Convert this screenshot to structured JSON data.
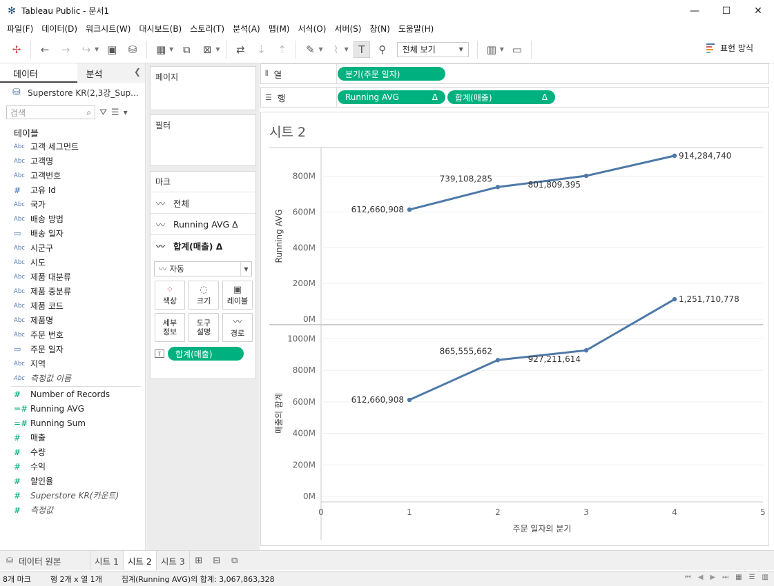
{
  "window": {
    "title": "Tableau Public - 문서1",
    "minimize": "—",
    "maximize": "☐",
    "close": "✕"
  },
  "menu": [
    "파일(F)",
    "데이터(D)",
    "워크시트(W)",
    "대시보드(B)",
    "스토리(T)",
    "분석(A)",
    "맵(M)",
    "서식(O)",
    "서버(S)",
    "창(N)",
    "도움말(H)"
  ],
  "toolbar": {
    "view_select": "전체 보기",
    "show_me": "표현 방식"
  },
  "datapane": {
    "tab_data": "데이터",
    "tab_analysis": "분석",
    "datasource": "Superstore KR(2,3강_Sup...",
    "search_placeholder": "검색",
    "tables_title": "테이블",
    "dimensions": [
      {
        "type": "Abc",
        "name": "고객 세그먼트"
      },
      {
        "type": "Abc",
        "name": "고객명"
      },
      {
        "type": "Abc",
        "name": "고객번호"
      },
      {
        "type": "#",
        "name": "고유 Id"
      },
      {
        "type": "Abc",
        "name": "국가"
      },
      {
        "type": "Abc",
        "name": "배송 방법"
      },
      {
        "type": "date",
        "name": "배송 일자"
      },
      {
        "type": "Abc",
        "name": "시군구"
      },
      {
        "type": "Abc",
        "name": "시도"
      },
      {
        "type": "Abc",
        "name": "제품 대분류"
      },
      {
        "type": "Abc",
        "name": "제품 중분류"
      },
      {
        "type": "Abc",
        "name": "제품 코드"
      },
      {
        "type": "Abc",
        "name": "제품명"
      },
      {
        "type": "Abc",
        "name": "주문 번호"
      },
      {
        "type": "date",
        "name": "주문 일자"
      },
      {
        "type": "Abc",
        "name": "지역"
      },
      {
        "type": "Abc",
        "name": "측정값 이름"
      }
    ],
    "measures": [
      {
        "type": "#",
        "name": "Number of Records"
      },
      {
        "type": "=#",
        "name": "Running AVG"
      },
      {
        "type": "=#",
        "name": "Running Sum"
      },
      {
        "type": "#",
        "name": "매출"
      },
      {
        "type": "#",
        "name": "수량"
      },
      {
        "type": "#",
        "name": "수익"
      },
      {
        "type": "#",
        "name": "할인율"
      },
      {
        "type": "#",
        "name": "Superstore KR(카운트)"
      },
      {
        "type": "#",
        "name": "측정값"
      }
    ]
  },
  "cards": {
    "pages": "페이지",
    "filters": "필터",
    "marks": "마크",
    "marks_rows": [
      "전체",
      "Running AVG Δ",
      "합계(매출) Δ"
    ],
    "mark_type": "자동",
    "buttons": {
      "color": "색상",
      "size": "크기",
      "label": "레이블",
      "detail_1": "세부",
      "detail_2": "정보",
      "tooltip_1": "도구",
      "tooltip_2": "설명",
      "path": "경로"
    },
    "label_pill": "합계(매출)"
  },
  "shelves": {
    "columns_label": "열",
    "rows_label": "행",
    "columns_pill": "분기(주문 일자)",
    "rows_pills": [
      "Running AVG",
      "합계(매출)"
    ],
    "delta": "Δ"
  },
  "sheet": {
    "title": "시트 2"
  },
  "chart_data": {
    "type": "line",
    "xlabel": "주문 일자의 분기",
    "x": [
      1,
      2,
      3,
      4
    ],
    "xlim": [
      0,
      5
    ],
    "xticks": [
      "0",
      "1",
      "2",
      "3",
      "4",
      "5"
    ],
    "panes": [
      {
        "ylabel": "Running AVG",
        "ylim": [
          0,
          960000000
        ],
        "yticks": [
          "0M",
          "200M",
          "400M",
          "600M",
          "800M"
        ],
        "values": [
          612660908,
          739108285,
          801809395,
          914284740
        ],
        "labels": [
          "612,660,908",
          "739,108,285",
          "801,809,395",
          "914,284,740"
        ]
      },
      {
        "ylabel": "매출의 합계",
        "ylim": [
          0,
          1090000000
        ],
        "yticks": [
          "0M",
          "200M",
          "400M",
          "600M",
          "800M",
          "1000M"
        ],
        "values": [
          612660908,
          865555662,
          927211614,
          1251710778
        ],
        "labels": [
          "612,660,908",
          "865,555,662",
          "927,211,614",
          "1,251,710,778"
        ]
      }
    ],
    "line_color": "#4e79a7",
    "grid": true
  },
  "tabs": {
    "source": "데이터 원본",
    "sheets": [
      "시트 1",
      "시트 2",
      "시트 3"
    ],
    "active": "시트 2"
  },
  "status": {
    "marks": "8개 마크",
    "dims": "행 2개 x 열 1개",
    "sum": "집계(Running AVG)의 합계: 3,067,863,328"
  }
}
